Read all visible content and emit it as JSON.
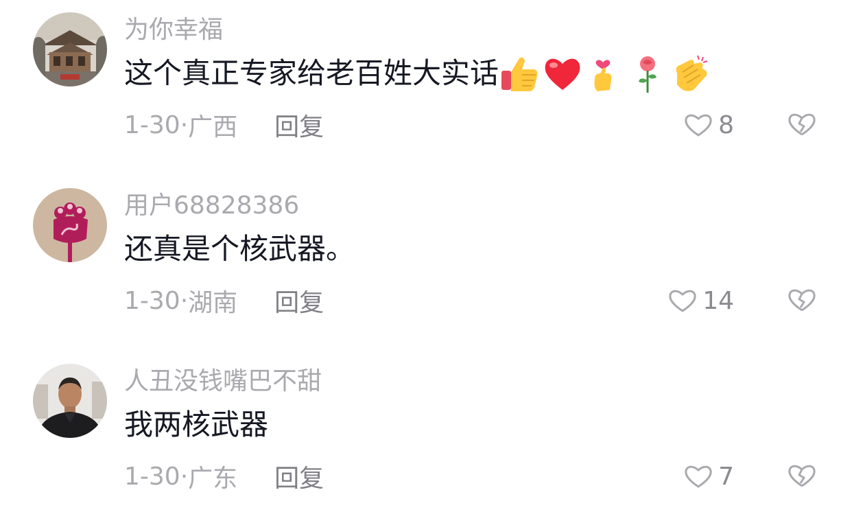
{
  "colors": {
    "username": "#a9a9ae",
    "text": "#161823",
    "meta": "#a9a9ae",
    "reply": "#7f7f86",
    "icon": "#a9a9ae"
  },
  "comments": [
    {
      "username": "为你幸福",
      "text": "这个真正专家给老百姓大实话",
      "emojis": [
        "thumbs-up",
        "red-heart",
        "finger-heart",
        "rose",
        "clapping-hands"
      ],
      "date": "1-30",
      "separator": "·",
      "region": "广西",
      "reply_label": "回复",
      "likes": "8",
      "avatar": "temple-photo"
    },
    {
      "username": "用户68828386",
      "text": "还真是个核武器。",
      "emojis": [],
      "date": "1-30",
      "separator": "·",
      "region": "湖南",
      "reply_label": "回复",
      "likes": "14",
      "avatar": "default-flower-avatar"
    },
    {
      "username": "人丑没钱嘴巴不甜",
      "text": "我两核武器",
      "emojis": [],
      "date": "1-30",
      "separator": "·",
      "region": "广东",
      "reply_label": "回复",
      "likes": "7",
      "avatar": "man-photo"
    }
  ]
}
